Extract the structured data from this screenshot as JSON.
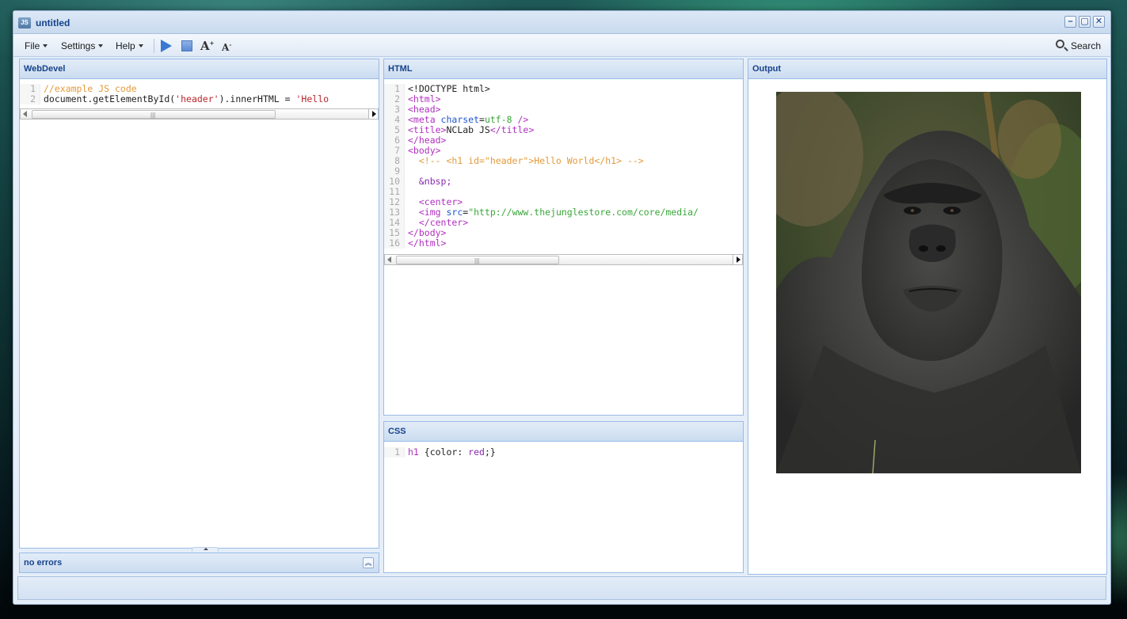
{
  "window": {
    "title": "untitled",
    "app_icon_text": "JS",
    "minimize": "–",
    "maximize": "▢",
    "close": "✕"
  },
  "toolbar": {
    "file": "File",
    "settings": "Settings",
    "help": "Help",
    "run_icon": "play-icon",
    "stop_icon": "stop-icon",
    "font_increase": "A",
    "font_decrease": "A",
    "search": "Search"
  },
  "panels": {
    "webdevel": {
      "title": "WebDevel",
      "lines": [
        {
          "n": "1",
          "segments": [
            {
              "cls": "c-com",
              "t": "//example JS code"
            }
          ]
        },
        {
          "n": "2",
          "segments": [
            {
              "cls": "",
              "t": "document.getElementById("
            },
            {
              "cls": "c-str",
              "t": "'header'"
            },
            {
              "cls": "",
              "t": ").innerHTML = "
            },
            {
              "cls": "c-str",
              "t": "'Hello"
            }
          ]
        }
      ]
    },
    "html": {
      "title": "HTML",
      "lines": [
        {
          "n": "1",
          "segments": [
            {
              "cls": "",
              "t": "<!DOCTYPE html>"
            }
          ]
        },
        {
          "n": "2",
          "segments": [
            {
              "cls": "c-tag",
              "t": "<html>"
            }
          ]
        },
        {
          "n": "3",
          "segments": [
            {
              "cls": "c-tag",
              "t": "<head>"
            }
          ]
        },
        {
          "n": "4",
          "segments": [
            {
              "cls": "c-tag",
              "t": "<meta "
            },
            {
              "cls": "c-attr",
              "t": "charset"
            },
            {
              "cls": "",
              "t": "="
            },
            {
              "cls": "c-val",
              "t": "utf-8"
            },
            {
              "cls": "c-tag",
              "t": " />"
            }
          ]
        },
        {
          "n": "5",
          "segments": [
            {
              "cls": "c-tag",
              "t": "<title>"
            },
            {
              "cls": "",
              "t": "NCLab JS"
            },
            {
              "cls": "c-tag",
              "t": "</title>"
            }
          ]
        },
        {
          "n": "6",
          "segments": [
            {
              "cls": "c-tag",
              "t": "</head>"
            }
          ]
        },
        {
          "n": "7",
          "segments": [
            {
              "cls": "c-tag",
              "t": "<body>"
            }
          ]
        },
        {
          "n": "8",
          "segments": [
            {
              "cls": "c-com",
              "t": "  <!-- <h1 id=\"header\">Hello World</h1> -->"
            }
          ]
        },
        {
          "n": "9",
          "segments": [
            {
              "cls": "",
              "t": ""
            }
          ]
        },
        {
          "n": "10",
          "segments": [
            {
              "cls": "c-kw",
              "t": "  &nbsp;"
            }
          ]
        },
        {
          "n": "11",
          "segments": [
            {
              "cls": "",
              "t": ""
            }
          ]
        },
        {
          "n": "12",
          "segments": [
            {
              "cls": "c-tag",
              "t": "  <center>"
            }
          ]
        },
        {
          "n": "13",
          "segments": [
            {
              "cls": "c-tag",
              "t": "  <img "
            },
            {
              "cls": "c-attr",
              "t": "src"
            },
            {
              "cls": "",
              "t": "="
            },
            {
              "cls": "c-val",
              "t": "\"http://www.thejunglestore.com/core/media/"
            }
          ]
        },
        {
          "n": "14",
          "segments": [
            {
              "cls": "c-tag",
              "t": "  </center>"
            }
          ]
        },
        {
          "n": "15",
          "segments": [
            {
              "cls": "c-tag",
              "t": "</body>"
            }
          ]
        },
        {
          "n": "16",
          "segments": [
            {
              "cls": "c-tag",
              "t": "</html>"
            }
          ]
        }
      ]
    },
    "css": {
      "title": "CSS",
      "lines": [
        {
          "n": "1",
          "segments": [
            {
              "cls": "c-tag",
              "t": "h1"
            },
            {
              "cls": "",
              "t": " {color: "
            },
            {
              "cls": "c-kw",
              "t": "red"
            },
            {
              "cls": "",
              "t": ";}"
            }
          ]
        }
      ]
    },
    "output": {
      "title": "Output"
    }
  },
  "errors": {
    "label": "no errors"
  },
  "colors": {
    "accent": "#15428b",
    "panel_border": "#99bbe8"
  }
}
